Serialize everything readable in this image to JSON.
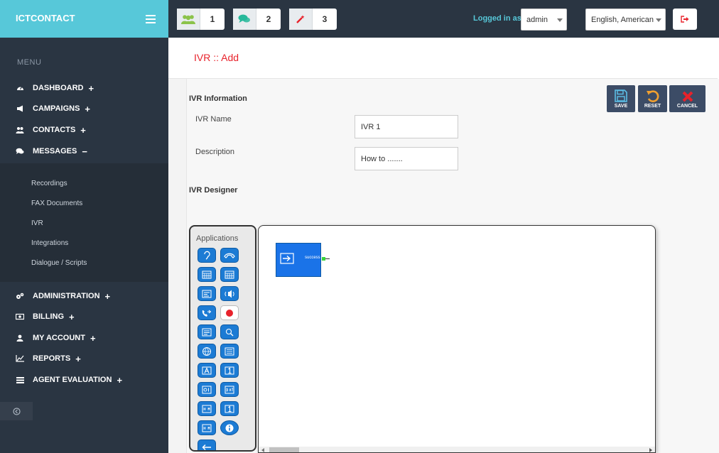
{
  "brand": {
    "title": "ICTCONTACT"
  },
  "sidebar": {
    "menu_heading": "MENU",
    "items": [
      {
        "label": "DASHBOARD",
        "icon": "dashboard-icon",
        "toggle": "+"
      },
      {
        "label": "CAMPAIGNS",
        "icon": "bullhorn-icon",
        "toggle": "+"
      },
      {
        "label": "CONTACTS",
        "icon": "users-icon",
        "toggle": "+"
      },
      {
        "label": "MESSAGES",
        "icon": "comments-icon",
        "toggle": "−"
      },
      {
        "label": "ADMINISTRATION",
        "icon": "cogs-icon",
        "toggle": "+"
      },
      {
        "label": "BILLING",
        "icon": "money-icon",
        "toggle": "+"
      },
      {
        "label": "MY ACCOUNT",
        "icon": "user-icon",
        "toggle": "+"
      },
      {
        "label": "REPORTS",
        "icon": "chart-icon",
        "toggle": "+"
      },
      {
        "label": "AGENT EVALUATION",
        "icon": "list-icon",
        "toggle": "+"
      }
    ],
    "submenu": [
      "Recordings",
      "FAX Documents",
      "IVR",
      "Integrations",
      "Dialogue / Scripts"
    ]
  },
  "topbar": {
    "buttons": [
      {
        "icon": "users-icon",
        "count": "1"
      },
      {
        "icon": "comments-icon",
        "count": "2"
      },
      {
        "icon": "magic-wand-icon",
        "count": "3"
      }
    ],
    "logged_label": "Logged in as :",
    "user": "admin",
    "language": "English, American"
  },
  "page": {
    "title": "IVR :: Add"
  },
  "form": {
    "section_info": "IVR Information",
    "name_label": "IVR Name",
    "name_value": "IVR 1",
    "desc_label": "Description",
    "desc_value": "How to .......",
    "section_designer": "IVR Designer"
  },
  "actions": {
    "save": "SAVE",
    "reset": "RESET",
    "cancel": "CANCEL"
  },
  "designer": {
    "apps_title": "Applications",
    "node_label": "success"
  },
  "colors": {
    "brand": "#57c8d9",
    "sidebar": "#2a3542",
    "title": "#e8222b",
    "action": "#3c4c66",
    "app_icon": "#1c7bd4"
  }
}
